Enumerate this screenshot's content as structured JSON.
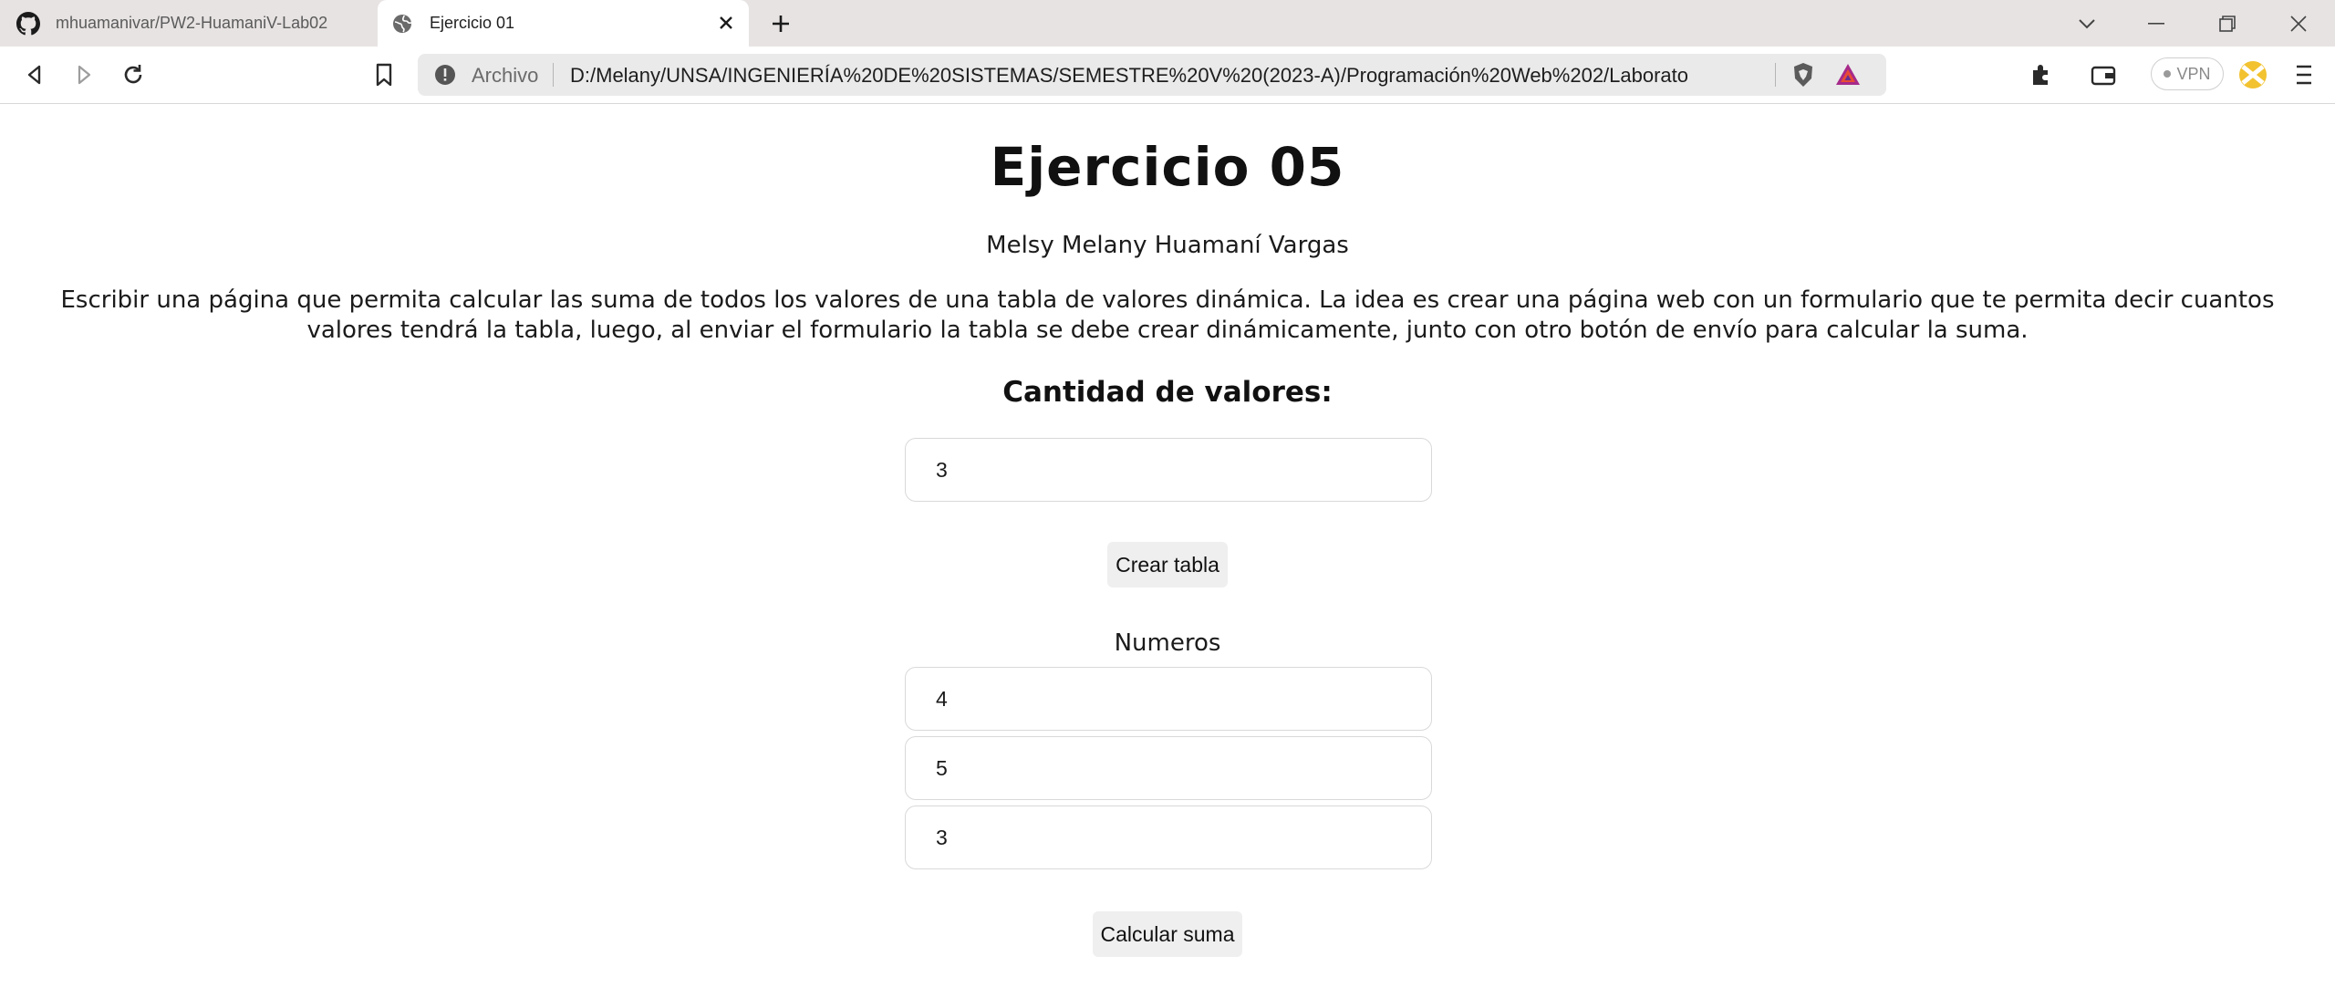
{
  "browser": {
    "tabs": [
      {
        "label": "mhuamanivar/PW2-HuamaniV-Lab02",
        "icon": "github-icon",
        "active": false
      },
      {
        "label": "Ejercicio 01",
        "icon": "globe-icon",
        "active": true
      }
    ],
    "address_bar": {
      "security_label": "Archivo",
      "url": "D:/Melany/UNSA/INGENIERÍA%20DE%20SISTEMAS/SEMESTRE%20V%20(2023-A)/Programación%20Web%202/Laboratorio..."
    },
    "vpn_label": "VPN"
  },
  "page": {
    "title": "Ejercicio 05",
    "author": "Melsy Melany Huamaní Vargas",
    "description": "Escribir una página que permita calcular las suma de todos los valores de una tabla de valores dinámica. La idea es crear una página web con un formulario que te permita decir cuantos valores tendrá la tabla, luego, al enviar el formulario la tabla se debe crear dinámicamente, junto con otro botón de envío para calcular la suma.",
    "quantity_heading": "Cantidad de valores:",
    "quantity_value": "3",
    "create_button": "Crear tabla",
    "numbers_label": "Numeros",
    "numbers": [
      "4",
      "5",
      "3"
    ],
    "sum_button": "Calcular suma"
  }
}
